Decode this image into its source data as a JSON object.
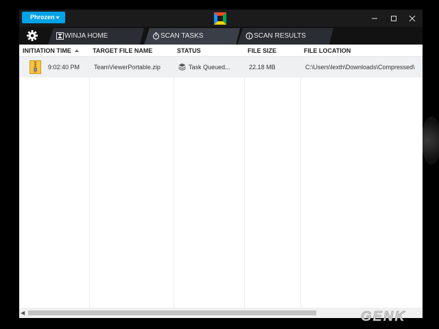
{
  "titlebar": {
    "brand_label": "Phrozen",
    "logo_icon": "winja-logo-icon",
    "controls": [
      "minimize-icon",
      "maximize-icon",
      "close-icon"
    ]
  },
  "tabs": [
    {
      "label": "WINJA HOME",
      "icon": "winja-home-icon"
    },
    {
      "label": "SCAN TASKS",
      "icon": "timer-icon"
    },
    {
      "label": "SCAN RESULTS",
      "icon": "info-icon"
    }
  ],
  "settings_icon": "gear-icon",
  "table": {
    "columns": [
      "INITIATION TIME",
      "TARGET FILE NAME",
      "STATUS",
      "FILE SIZE",
      "FILE LOCATION"
    ],
    "sorted_column": "INITIATION TIME",
    "rows": [
      {
        "icon": "zip-file-icon",
        "time": "9:02:40 PM",
        "file_name": "TeamViewerPortable.zip",
        "status_icon": "stack-icon",
        "status": "Task Queued...",
        "size": "22.18 MB",
        "location": "C:\\Users\\lexth\\Downloads\\Compressed\\"
      }
    ]
  },
  "watermark": "GENK",
  "colors": {
    "brand": "#00a2e8",
    "titlebar": "#1b1b1b",
    "tab_active": "#3a3f47",
    "tab_inactive": "#2a2d33",
    "row_bg": "#eef0f2"
  }
}
